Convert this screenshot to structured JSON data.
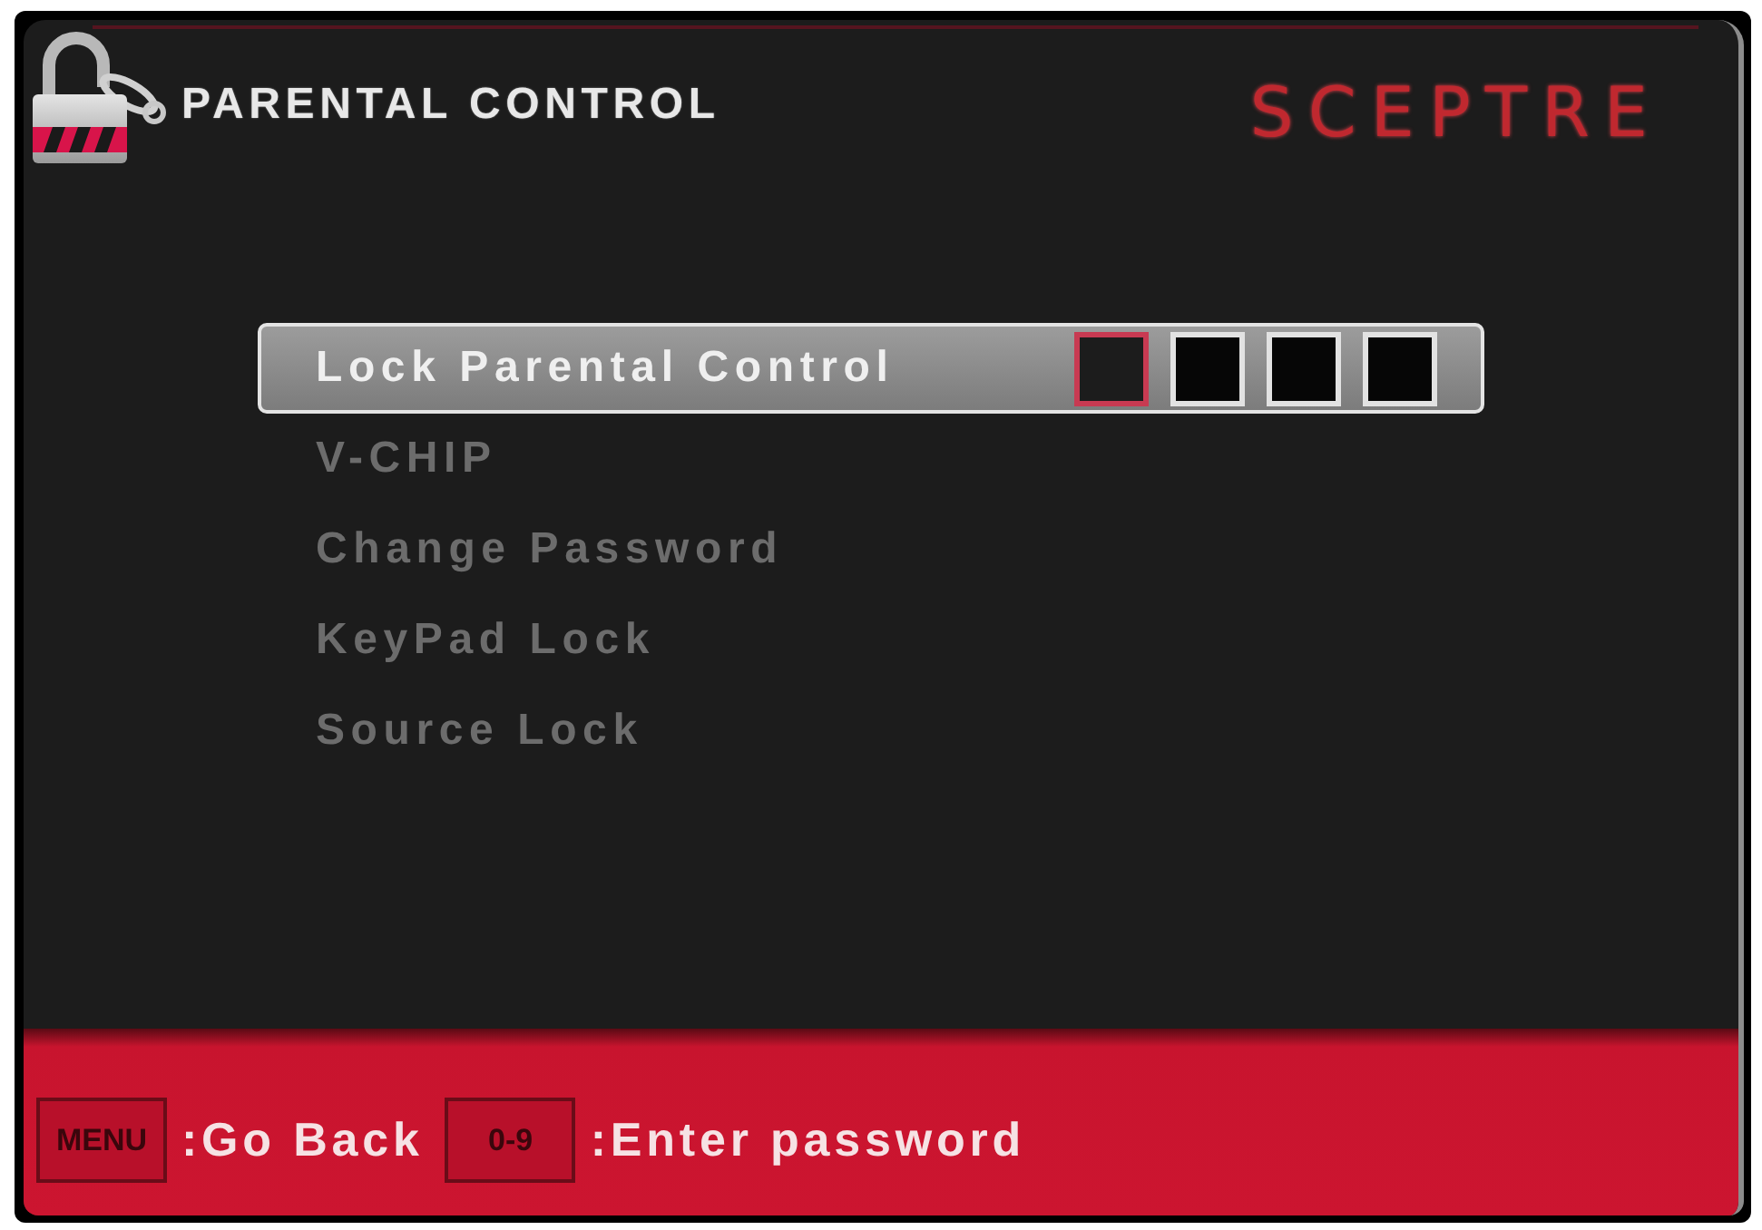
{
  "header": {
    "title": "PARENTAL CONTROL",
    "logo": "SCEPTRE"
  },
  "menu": {
    "items": [
      {
        "label": "Lock Parental Control",
        "kind": "password",
        "selected": true,
        "disabled": false,
        "password_boxes": [
          {
            "selected": true
          },
          {
            "selected": false
          },
          {
            "selected": false
          },
          {
            "selected": false
          }
        ]
      },
      {
        "label": "V-CHIP",
        "kind": "submenu",
        "selected": false,
        "disabled": true
      },
      {
        "label": "Change Password",
        "kind": "submenu",
        "selected": false,
        "disabled": true
      },
      {
        "label": "KeyPad Lock",
        "kind": "submenu",
        "selected": false,
        "disabled": true
      },
      {
        "label": "Source Lock",
        "kind": "submenu",
        "selected": false,
        "disabled": true
      }
    ]
  },
  "footer": {
    "hints": [
      {
        "key": "MENU",
        "action": ":Go Back"
      },
      {
        "key": "0-9",
        "action": ":Enter password"
      }
    ]
  }
}
